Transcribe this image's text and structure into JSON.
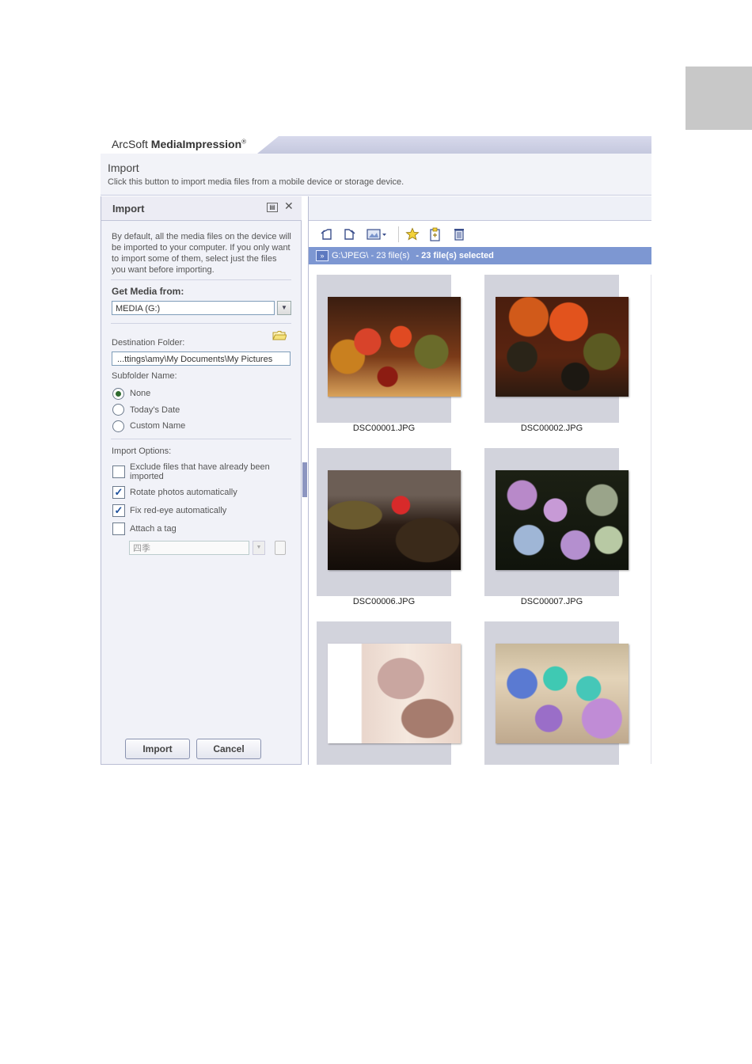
{
  "app": {
    "brand_prefix": "ArcSoft ",
    "brand_name": "MediaImpression",
    "brand_mark": "®"
  },
  "header": {
    "title": "Import",
    "description": "Click this button to import media files from a mobile device or storage device."
  },
  "left_panel": {
    "title": "Import",
    "description": "By default, all the media files on the device will be imported to your computer. If you only want to import some of them, select just the files you want before importing.",
    "get_media_label": "Get Media from:",
    "media_value": "MEDIA (G:)",
    "destination_label": "Destination Folder:",
    "destination_value": "...ttings\\amy\\My Documents\\My Pictures",
    "subfolder_label": "Subfolder Name:",
    "subfolder_options": [
      {
        "label": "None",
        "selected": true
      },
      {
        "label": "Today's Date",
        "selected": false
      },
      {
        "label": "Custom Name",
        "selected": false
      }
    ],
    "import_options_label": "Import Options:",
    "options": [
      {
        "label": "Exclude files that have already been imported",
        "checked": false
      },
      {
        "label": "Rotate photos automatically",
        "checked": true
      },
      {
        "label": "Fix red-eye automatically",
        "checked": true
      },
      {
        "label": "Attach a tag",
        "checked": false
      }
    ],
    "tag_value": "四季",
    "import_button": "Import",
    "cancel_button": "Cancel"
  },
  "right_panel": {
    "path_text": "G:\\JPEG\\ - 23 file(s)",
    "selected_text": "- 23 file(s) selected",
    "thumbnails": [
      {
        "caption": "DSC00001.JPG"
      },
      {
        "caption": "DSC00002.JPG"
      },
      {
        "caption": "DSC00006.JPG"
      },
      {
        "caption": "DSC00007.JPG"
      },
      {
        "caption": ""
      },
      {
        "caption": ""
      }
    ]
  },
  "colors": {
    "path_bar": "#7d97d2",
    "panel_bg": "#f1f2f8",
    "thumb_bg": "#d2d3dc",
    "check_mark": "#1d4f9c"
  }
}
